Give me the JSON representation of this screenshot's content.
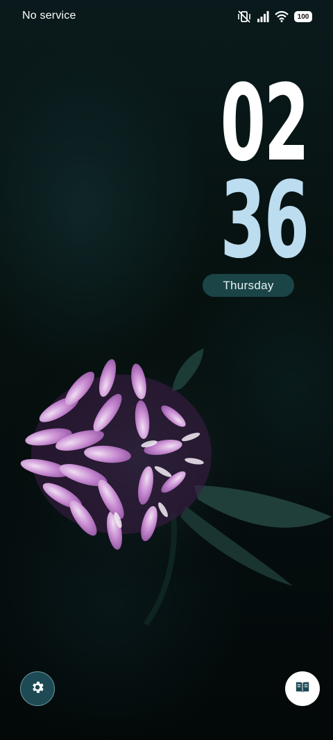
{
  "status_bar": {
    "carrier": "No service",
    "icons": [
      "vibrate-off-icon",
      "signal-icon",
      "wifi-icon"
    ],
    "battery": "100"
  },
  "clock": {
    "hours": "02",
    "minutes": "36",
    "day": "Thursday"
  },
  "shortcuts": {
    "left": "settings-icon",
    "right": "book-icon"
  },
  "colors": {
    "clock_hours": "#ffffff",
    "clock_minutes": "#bcdcef",
    "day_pill": "#1b4447",
    "settings_shortcut": "#1d4a54"
  }
}
